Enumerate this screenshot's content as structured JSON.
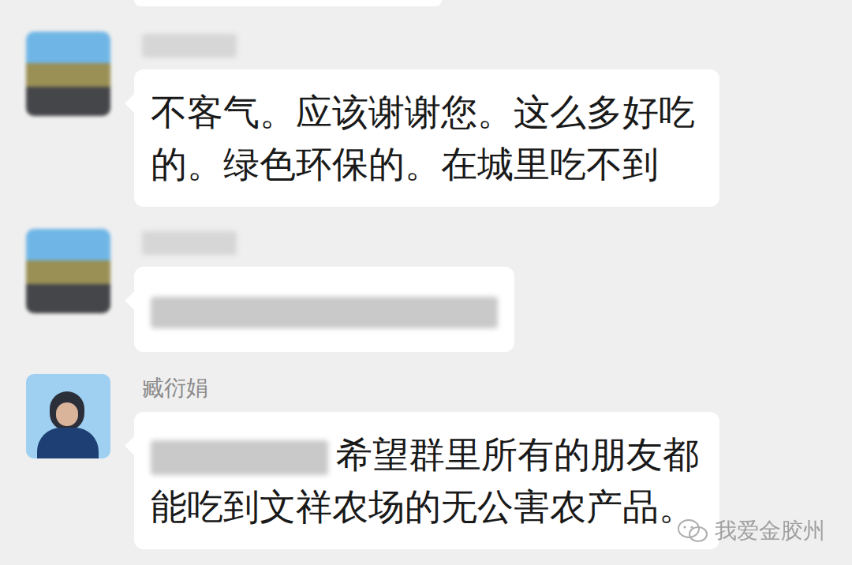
{
  "messages": [
    {
      "sender": "",
      "sender_blurred": true,
      "avatar": "landscape",
      "mention_blurred": false,
      "text": "不客气。应该谢谢您。这么多好吃的。绿色环保的。在城里吃不到",
      "text_blurred": false
    },
    {
      "sender": "",
      "sender_blurred": true,
      "avatar": "landscape",
      "mention_blurred": false,
      "text": "",
      "text_blurred": true
    },
    {
      "sender": "臧衍娟",
      "sender_blurred": false,
      "avatar": "portrait",
      "mention_blurred": true,
      "text": "希望群里所有的朋友都能吃到文祥农场的无公害农产品。",
      "text_blurred": false
    }
  ],
  "watermark": {
    "text": "我爱金胶州"
  }
}
